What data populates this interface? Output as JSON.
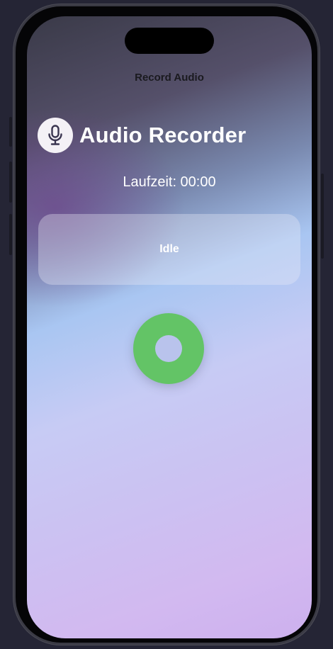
{
  "nav": {
    "title": "Record Audio"
  },
  "header": {
    "icon": "microphone-icon",
    "title": "Audio Recorder"
  },
  "runtime": {
    "text": "Laufzeit: 00:00"
  },
  "status": {
    "text": "Idle"
  },
  "record_button": {
    "color": "#63c466",
    "state": "idle"
  },
  "colors": {
    "accent_green": "#63c466",
    "title_text": "#ffffff"
  }
}
